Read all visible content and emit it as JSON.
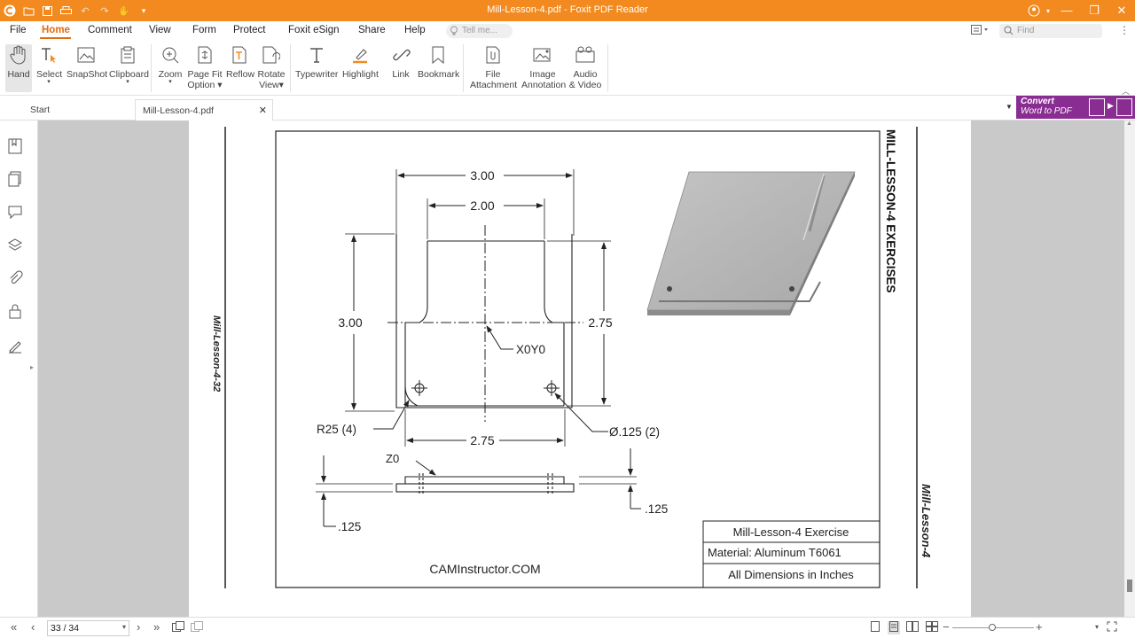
{
  "window": {
    "title": "Mill-Lesson-4.pdf - Foxit PDF Reader",
    "brand_color": "#f28a1f"
  },
  "menu": {
    "items": [
      "File",
      "Home",
      "Comment",
      "View",
      "Form",
      "Protect",
      "Foxit eSign",
      "Share",
      "Help"
    ],
    "active": "Home",
    "tell_me_placeholder": "Tell me...",
    "find_placeholder": "Find"
  },
  "ribbon": {
    "hand": "Hand",
    "select": "Select",
    "snapshot": "SnapShot",
    "clipboard": "Clipboard",
    "zoom": "Zoom",
    "page_fit_1": "Page Fit",
    "page_fit_2": "Option",
    "reflow": "Reflow",
    "rotate_1": "Rotate",
    "rotate_2": "View",
    "typewriter": "Typewriter",
    "highlight": "Highlight",
    "link": "Link",
    "bookmark": "Bookmark",
    "file_att_1": "File",
    "file_att_2": "Attachment",
    "image_ann_1": "Image",
    "image_ann_2": "Annotation",
    "audio_1": "Audio",
    "audio_2": "& Video"
  },
  "tabs": {
    "start": "Start",
    "doc": "Mill-Lesson-4.pdf"
  },
  "promo": {
    "line1": "Convert",
    "line2": "Word to PDF",
    "color": "#8a2d93"
  },
  "drawing": {
    "title_vertical": "MILL-LESSON-4 EXERCISES",
    "left_margin_label": "Mill-Lesson-4-32",
    "right_margin_label": "Mill-Lesson-4",
    "dim_top_outer": "3.00",
    "dim_top_inner": "2.00",
    "dim_left": "3.00",
    "dim_right": "2.75",
    "dim_bottom": "2.75",
    "origin_label": "X0Y0",
    "radius_label": "R25 (4)",
    "hole_label": "Ø.125  (2)",
    "z0_label": "Z0",
    "thickness_left": ".125",
    "thickness_right": ".125",
    "site": "CAMInstructor.COM",
    "tb_title": "Mill-Lesson-4 Exercise",
    "tb_material": "Material: Aluminum T6061",
    "tb_units": "All Dimensions in Inches"
  },
  "status": {
    "page_indicator": "33 / 34"
  }
}
